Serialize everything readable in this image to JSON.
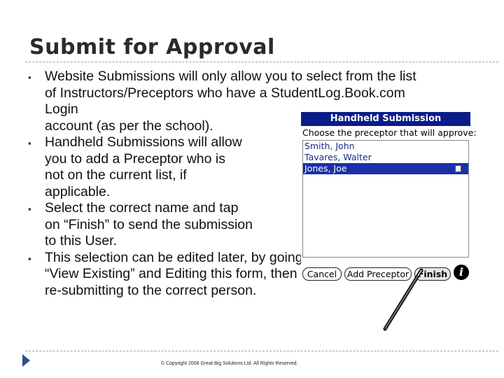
{
  "slide": {
    "title": "Submit for Approval",
    "footer": "© Copyright 2008 Great Big Solutions Ltd. All Rights Reserved."
  },
  "bullets": [
    {
      "lines": [
        "Website Submissions will only allow you to select from the list",
        "of Instructors/Preceptors who have a StudentLog.Book.com",
        "Login",
        "account (as per the school)."
      ]
    },
    {
      "lines": [
        "Handheld Submissions will allow",
        "you to add a Preceptor who is",
        "not on the current list, if",
        "applicable."
      ]
    },
    {
      "lines": [
        "Select the correct name and tap",
        "on “Finish” to send the submission",
        "to this User."
      ]
    },
    {
      "lines": [
        "This selection can be edited later, by going to",
        "“View Existing” and Editing this form, then",
        "re-submitting to the correct person."
      ]
    }
  ],
  "handheld": {
    "header": "Handheld Submission",
    "prompt": "Choose the preceptor that will approve:",
    "preceptors": [
      "Smith, John",
      "Tavares, Walter",
      "Jones, Joe"
    ],
    "selected_index": 2,
    "buttons": {
      "cancel": "Cancel",
      "add_preceptor": "Add Preceptor",
      "finish": "Finish"
    },
    "info": "i"
  },
  "icons": {
    "bullet": "square-bullet-icon",
    "nav": "next-arrow-icon",
    "info": "info-icon",
    "stylus": "stylus-icon"
  },
  "colors": {
    "header_bg": "#0a1c8a",
    "selected_bg": "#1a30a8",
    "list_text": "#1a2a8a",
    "nav_arrow": "#2f4f8f"
  }
}
